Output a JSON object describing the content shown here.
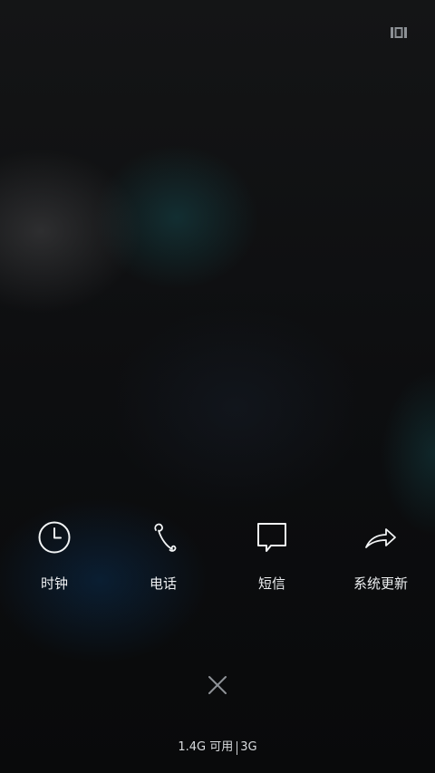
{
  "top_bar": {
    "manage_icon": "multi-window-icon"
  },
  "apps": [
    {
      "label": "时钟",
      "icon": "clock-icon"
    },
    {
      "label": "电话",
      "icon": "phone-icon"
    },
    {
      "label": "短信",
      "icon": "message-icon"
    },
    {
      "label": "系统更新",
      "icon": "share-arrow-icon"
    }
  ],
  "close": {
    "icon": "close-icon"
  },
  "memory": {
    "available": "1.4G 可用",
    "total": "3G"
  }
}
